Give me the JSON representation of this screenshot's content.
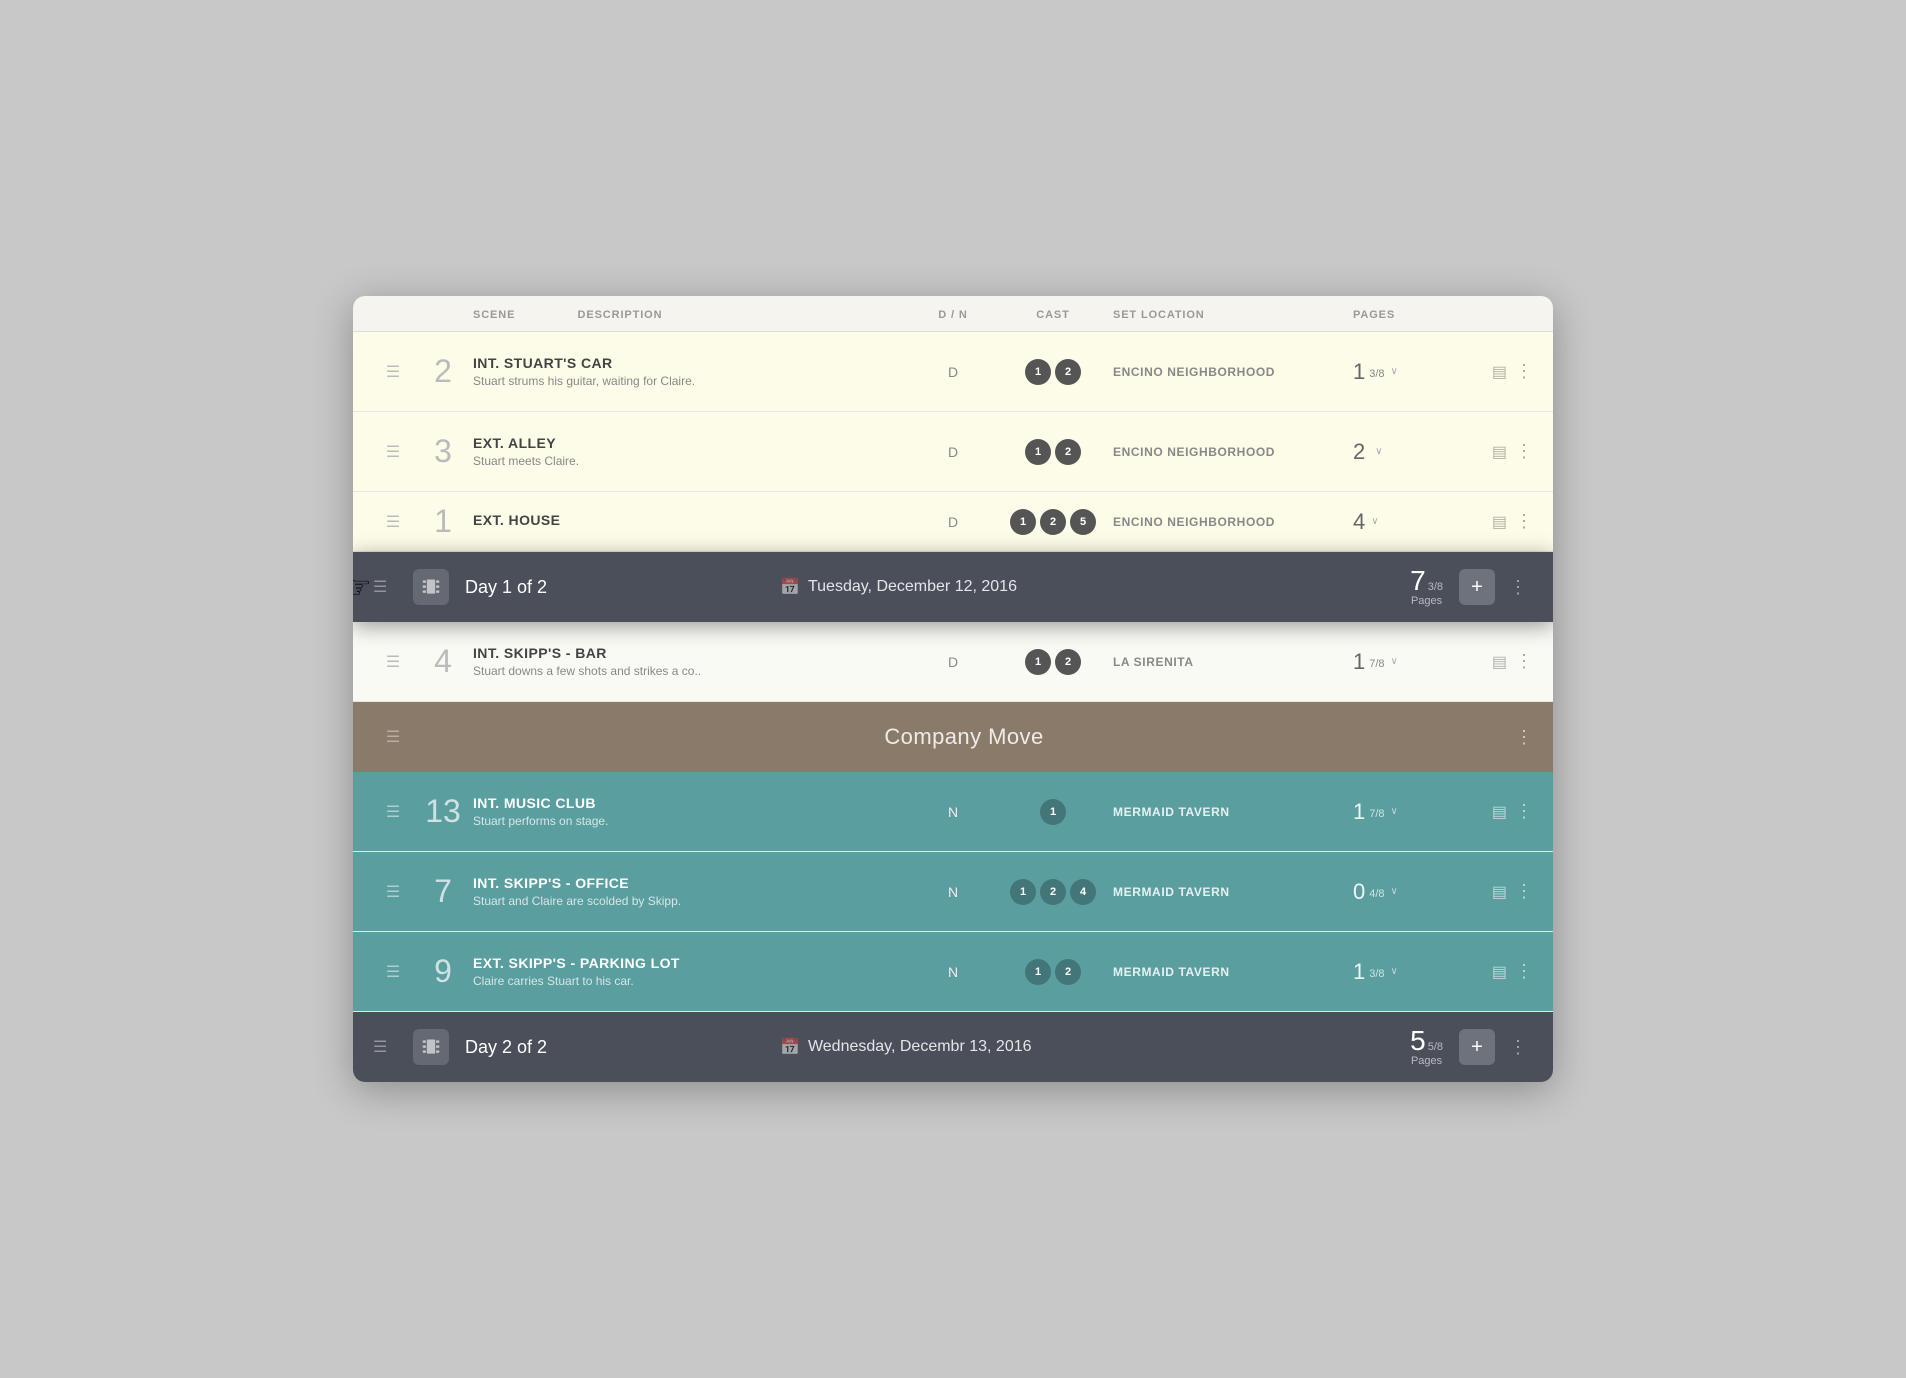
{
  "header": {
    "columns": [
      "SCENE",
      "DESCRIPTION",
      "D / N",
      "CAST",
      "SET LOCATION",
      "PAGES"
    ]
  },
  "scenes": [
    {
      "id": "scene-2",
      "num": "2",
      "title": "INT. STUART'S CAR",
      "subtitle": "Stuart strums his guitar, waiting for Claire.",
      "dm": "D",
      "cast": [
        "1",
        "2"
      ],
      "location": "ENCINO NEIGHBORHOOD",
      "pages_main": "1",
      "pages_frac": "3/8",
      "tint": "yellow"
    },
    {
      "id": "scene-3",
      "num": "3",
      "title": "EXT. ALLEY",
      "subtitle": "Stuart meets Claire.",
      "dm": "D",
      "cast": [
        "1",
        "2"
      ],
      "location": "ENCINO NEIGHBORHOOD",
      "pages_main": "2",
      "pages_frac": "",
      "tint": "yellow"
    },
    {
      "id": "scene-1",
      "num": "1",
      "title": "EXT. HOUSE",
      "subtitle": "",
      "dm": "D",
      "cast": [
        "1",
        "2",
        "5"
      ],
      "location": "ENCINO NEIGHBORHOOD",
      "pages_main": "4",
      "pages_frac": "",
      "tint": "yellow"
    }
  ],
  "day1": {
    "label": "Day 1 of 2",
    "date": "Tuesday, December 12, 2016",
    "pages_num": "7",
    "pages_frac": "3/8",
    "pages_label": "Pages"
  },
  "scene4": {
    "num": "4",
    "title": "INT. SKIPP'S - BAR",
    "subtitle": "Stuart downs a few shots and strikes a co..",
    "dm": "D",
    "cast": [
      "1",
      "2"
    ],
    "location": "LA SIRENITA",
    "pages_main": "1",
    "pages_frac": "7/8",
    "tint": "normal"
  },
  "companyMove": {
    "label": "Company Move"
  },
  "tealScenes": [
    {
      "id": "scene-13",
      "num": "13",
      "title": "INT. MUSIC CLUB",
      "subtitle": "Stuart performs on stage.",
      "dm": "N",
      "cast": [
        "1"
      ],
      "location": "MERMAID TAVERN",
      "pages_main": "1",
      "pages_frac": "7/8"
    },
    {
      "id": "scene-7",
      "num": "7",
      "title": "INT. SKIPP'S - OFFICE",
      "subtitle": "Stuart and Claire are scolded by Skipp.",
      "dm": "N",
      "cast": [
        "1",
        "2",
        "4"
      ],
      "location": "MERMAID TAVERN",
      "pages_main": "0",
      "pages_frac": "4/8"
    },
    {
      "id": "scene-9",
      "num": "9",
      "title": "EXT. SKIPP'S - PARKING LOT",
      "subtitle": "Claire carries Stuart to his car.",
      "dm": "N",
      "cast": [
        "1",
        "2"
      ],
      "location": "MERMAID TAVERN",
      "pages_main": "1",
      "pages_frac": "3/8"
    }
  ],
  "day2": {
    "label": "Day 2 of 2",
    "date": "Wednesday, Decembr 13, 2016",
    "pages_num": "5",
    "pages_frac": "5/8",
    "pages_label": "Pages"
  },
  "icons": {
    "drag": "☰",
    "calendar": "📅",
    "plus": "+",
    "more": "⋮",
    "stacks": "▤",
    "chevron_down": "∨"
  }
}
